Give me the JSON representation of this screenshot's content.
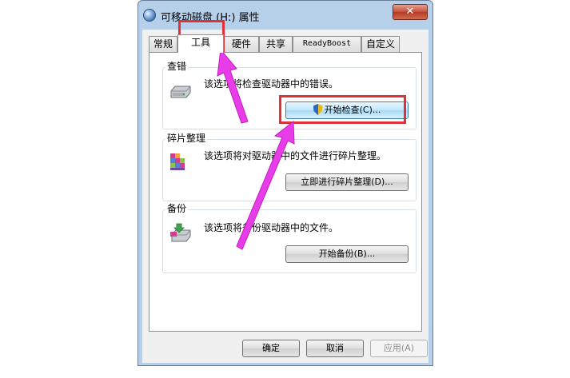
{
  "window": {
    "title": "可移动磁盘 (H:) 属性",
    "close_symbol": "✕"
  },
  "tabs": [
    {
      "label": "常规",
      "active": false
    },
    {
      "label": "工具",
      "active": true
    },
    {
      "label": "硬件",
      "active": false
    },
    {
      "label": "共享",
      "active": false
    },
    {
      "label": "ReadyBoost",
      "active": false
    },
    {
      "label": "自定义",
      "active": false
    }
  ],
  "error_check": {
    "title": "查错",
    "description": "该选项将检查驱动器中的错误。",
    "button": "开始检查(C)...",
    "icon": "drive-icon"
  },
  "defrag": {
    "title": "碎片整理",
    "description": "该选项将对驱动器中的文件进行碎片整理。",
    "button": "立即进行碎片整理(D)...",
    "icon": "defrag-icon"
  },
  "backup": {
    "title": "备份",
    "description": "该选项将备份驱动器中的文件。",
    "button": "开始备份(B)...",
    "icon": "backup-icon"
  },
  "footer": {
    "ok": "确定",
    "cancel": "取消",
    "apply": "应用(A)"
  },
  "annotation_colors": {
    "highlight_box": "#e0313a",
    "arrow": "#e83ce8"
  }
}
